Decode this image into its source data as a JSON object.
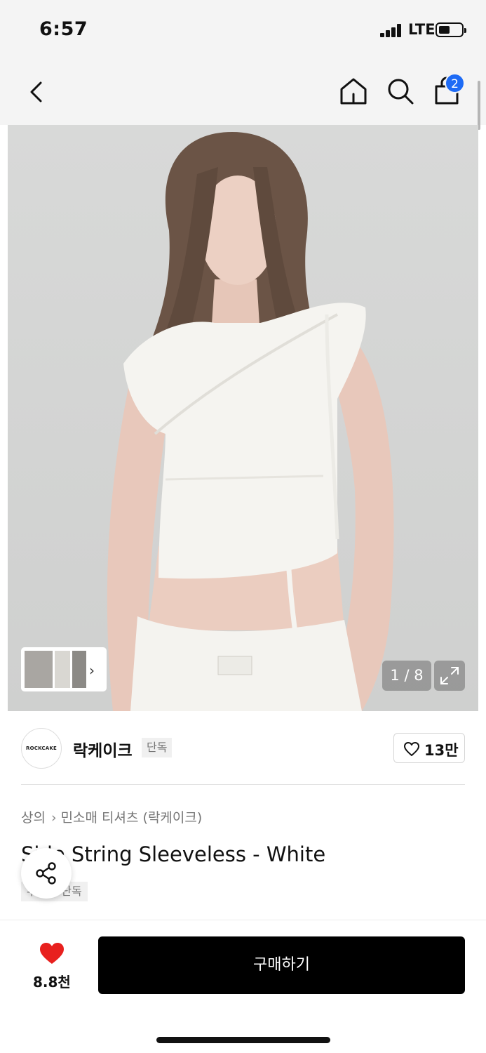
{
  "status_bar": {
    "time": "6:57",
    "network": "LTE"
  },
  "nav": {
    "back_icon": "chevron-left-icon",
    "home_icon": "home-icon",
    "search_icon": "search-icon",
    "cart_icon": "shopping-bag-icon",
    "cart_badge": "2"
  },
  "gallery": {
    "counter": "1 / 8",
    "expand_icon": "expand-icon"
  },
  "brand": {
    "logo_text": "ROCKCAKE",
    "name": "락케이크",
    "tag": "단독",
    "like_count": "13만"
  },
  "product": {
    "breadcrumb": [
      "상의",
      "민소매 티셔츠 (락케이크)"
    ],
    "title": "Side String Sleeveless - White",
    "tag": "무신사 단독"
  },
  "bottom": {
    "favorite_count": "8.8천",
    "buy_label": "구매하기"
  },
  "colors": {
    "accent": "#1e6bf5",
    "heart": "#e8201e",
    "buy_button": "#000000"
  }
}
